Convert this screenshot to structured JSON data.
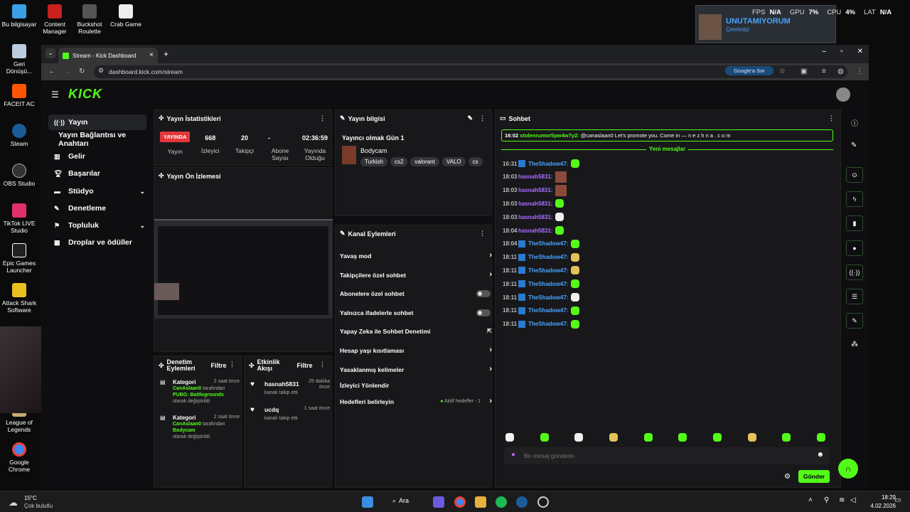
{
  "desktop": {
    "icons": [
      {
        "label": "Bu bilgisayar",
        "icon": "computer-icon"
      },
      {
        "label": "Content Manager",
        "icon": "content-manager-icon"
      },
      {
        "label": "Buckshot Roulette",
        "icon": "buckshot-icon"
      },
      {
        "label": "Crab Game",
        "icon": "crab-game-icon"
      },
      {
        "label": "Geri Dönüşü...",
        "icon": "recycle-bin-icon"
      },
      {
        "label": "FACEIT AC",
        "icon": "faceit-icon"
      },
      {
        "label": "Steam",
        "icon": "steam-icon"
      },
      {
        "label": "OBS Studio",
        "icon": "obs-icon"
      },
      {
        "label": "TikTok LIVE Studio",
        "icon": "tiktok-icon"
      },
      {
        "label": "Epic Games Launcher",
        "icon": "epic-icon"
      },
      {
        "label": "Attack Shark Software",
        "icon": "attack-shark-icon"
      },
      {
        "label": "League of Legends",
        "icon": "lol-icon"
      },
      {
        "label": "Google Chrome",
        "icon": "chrome-icon"
      }
    ]
  },
  "overlay": {
    "name": "UNUTAMIYORUM",
    "status": "Çevrimiçi"
  },
  "perf": {
    "fps_label": "FPS",
    "fps": "N/A",
    "gpu_label": "GPU",
    "gpu": "7%",
    "cpu_label": "CPU",
    "cpu": "4%",
    "lat_label": "LAT",
    "lat": "N/A"
  },
  "browser": {
    "tab_title": "Stream - Kick Dashboard",
    "url": "dashboard.kick.com/stream",
    "google_sor": "Google'a Sor"
  },
  "sidebar": {
    "items": [
      {
        "label": "Yayın",
        "icon": "broadcast-icon"
      },
      {
        "label": "Yayın Bağlantısı ve Anahtarı",
        "icon": ""
      },
      {
        "label": "Gelir",
        "icon": "chart-icon"
      },
      {
        "label": "Başarılar",
        "icon": "trophy-icon"
      },
      {
        "label": "Stüdyo",
        "icon": "studio-icon"
      },
      {
        "label": "Denetleme",
        "icon": "wrench-icon"
      },
      {
        "label": "Topluluk",
        "icon": "community-icon"
      },
      {
        "label": "Droplar ve ödüller",
        "icon": "gift-icon"
      }
    ]
  },
  "stats": {
    "title": "Yayın İstatistikleri",
    "live": "YAYINDA",
    "live_label": "Yayın",
    "viewers": "668",
    "viewers_label": "İzleyici",
    "followers": "20",
    "followers_label": "Takipçi",
    "subs": "-",
    "subs_label": "Abone Sayısı",
    "duration": "02:36:59",
    "duration_label": "Yayında Olduğu"
  },
  "preview": {
    "title": "Yayın Ön İzlemesi"
  },
  "info": {
    "title": "Yayın bilgisi",
    "stream_title": "Yayıncı olmak Gün 1",
    "category": "Bodycam",
    "tags": [
      "Turkish",
      "cs2",
      "valorant",
      "VALO",
      "cs"
    ]
  },
  "actions": {
    "title": "Kanal Eylemleri",
    "items": [
      "Yavaş mod",
      "Takipçilere özel sohbet",
      "Abonelere özel sohbet",
      "Yalnızca ifadelerle sohbet",
      "Yapay Zeka ile Sohbet Denetimi",
      "Hesap yaşı kısıtlaması",
      "Yasaklanmış kelimeler",
      "İzleyici Yönlendir",
      "Hedefleri belirleyin"
    ],
    "goals_status": "Aktif hedefler - 1"
  },
  "moderation": {
    "title": "Denetim Eylemleri",
    "filter": "Filtre",
    "entries": [
      {
        "title": "Kategori",
        "time": "2 saat önce",
        "actor": "CanAslaan0",
        "mid": "tarafından",
        "value": "PUBG: Battlegrounds",
        "tail": "olarak değiştirildi"
      },
      {
        "title": "Kategori",
        "time": "2 saat önce",
        "actor": "CanAslaan0",
        "mid": "tarafından",
        "value": "Bodycam",
        "tail": "olarak değiştirildi"
      }
    ]
  },
  "activity": {
    "title": "Etkinlik Akışı",
    "filter": "Filtre",
    "entries": [
      {
        "user": "hasnah5831",
        "time": "25 dakika önce",
        "text": "kanalı takip etti"
      },
      {
        "user": "ucdq",
        "time": "1 saat önce",
        "text": "kanalı takip etti"
      }
    ]
  },
  "chat": {
    "title": "Sohbet",
    "pinned": {
      "time": "16:02",
      "user": "stolenrumor5pw4w7y2:",
      "text": "@canaslaan0 Let's promote you. Come in — n e z h n a . c o m"
    },
    "new_messages": "Yeni mesajlar",
    "messages": [
      {
        "time": "16:31",
        "user": "TheShadow47:",
        "color": "#4aa3ff"
      },
      {
        "time": "18:03",
        "user": "hasnah5831:",
        "color": "#a970ff"
      },
      {
        "time": "18:03",
        "user": "hasnah5831:",
        "color": "#a970ff"
      },
      {
        "time": "18:03",
        "user": "hasnah5831:",
        "color": "#a970ff"
      },
      {
        "time": "18:03",
        "user": "hasnah5831:",
        "color": "#a970ff"
      },
      {
        "time": "18:04",
        "user": "hasnah5831:",
        "color": "#a970ff"
      },
      {
        "time": "18:04",
        "user": "TheShadow47:",
        "color": "#4aa3ff"
      },
      {
        "time": "18:11",
        "user": "TheShadow47:",
        "color": "#4aa3ff"
      },
      {
        "time": "18:11",
        "user": "TheShadow47:",
        "color": "#4aa3ff"
      },
      {
        "time": "18:11",
        "user": "TheShadow47:",
        "color": "#4aa3ff"
      },
      {
        "time": "18:11",
        "user": "TheShadow47:",
        "color": "#4aa3ff"
      },
      {
        "time": "18:11",
        "user": "TheShadow47:",
        "color": "#4aa3ff"
      },
      {
        "time": "18:11",
        "user": "TheShadow47:",
        "color": "#4aa3ff"
      }
    ],
    "placeholder": "Bir mesaj gönderin",
    "send": "Gönder"
  },
  "taskbar": {
    "weather_temp": "15°C",
    "weather_desc": "Çok bulutlu",
    "search": "Ara",
    "time": "18:29",
    "date": "4.02.2026"
  },
  "colors": {
    "accent": "#53fc18",
    "live": "#e5373b",
    "bg": "#0e0e10",
    "panel": "#18181b"
  }
}
